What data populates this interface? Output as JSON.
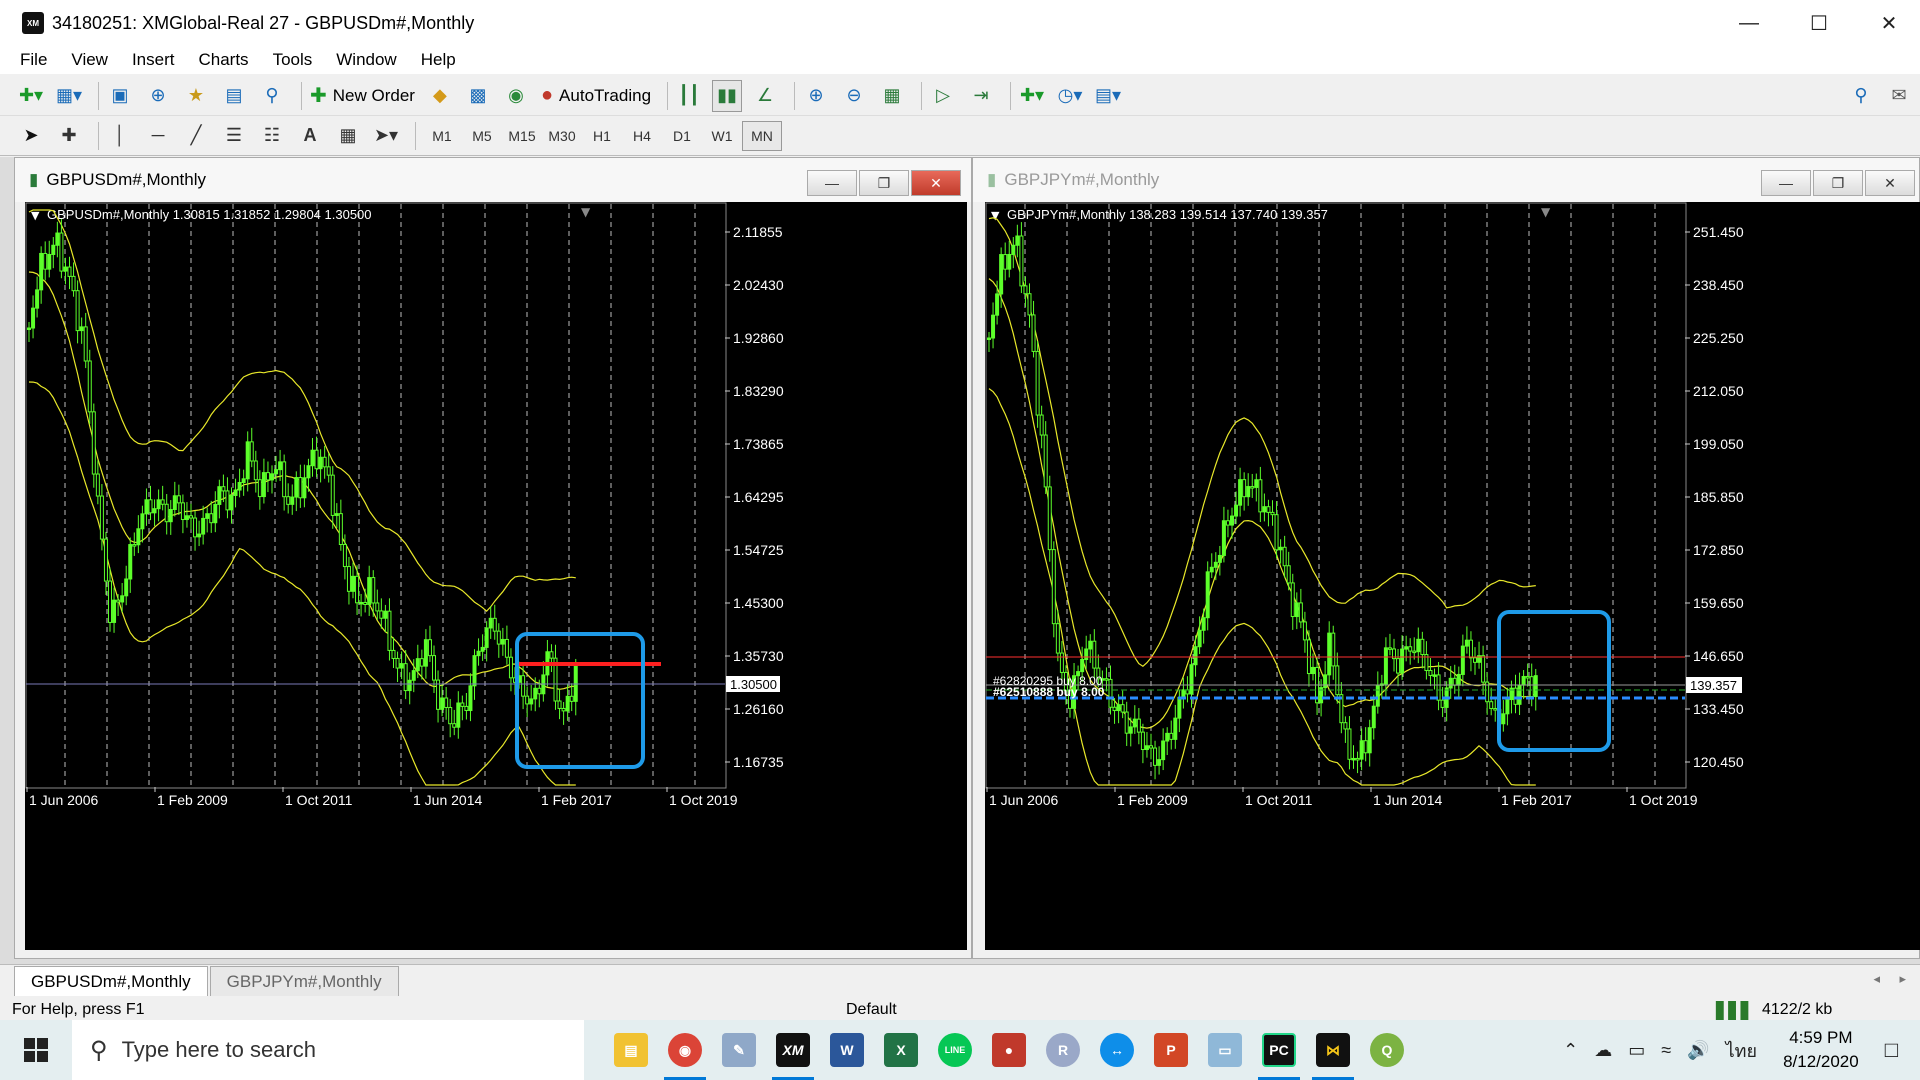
{
  "window": {
    "title": "34180251: XMGlobal-Real 27 - GBPUSDm#,Monthly",
    "logo_text": "XM"
  },
  "menu": [
    "File",
    "View",
    "Insert",
    "Charts",
    "Tools",
    "Window",
    "Help"
  ],
  "toolbar": {
    "new_order": "New Order",
    "auto_trading": "AutoTrading"
  },
  "timeframes": [
    "M1",
    "M5",
    "M15",
    "M30",
    "H1",
    "H4",
    "D1",
    "W1",
    "MN"
  ],
  "active_timeframe": "MN",
  "chart1": {
    "title": "GBPUSDm#,Monthly",
    "header": "GBPUSDm#,Monthly  1.30815 1.31852 1.29804 1.30500",
    "price_labels": [
      "2.11855",
      "2.02430",
      "1.92860",
      "1.83290",
      "1.73865",
      "1.64295",
      "1.54725",
      "1.45300",
      "1.35730",
      "1.26160",
      "1.16735"
    ],
    "current_price": "1.30500",
    "date_labels": [
      "1 Jun 2006",
      "1 Feb 2009",
      "1 Oct 2011",
      "1 Jun 2014",
      "1 Feb 2017",
      "1 Oct 2019"
    ]
  },
  "chart2": {
    "title": "GBPJPYm#,Monthly",
    "header": "GBPJPYm#,Monthly  138.283 139.514 137.740 139.357",
    "price_labels": [
      "251.450",
      "238.450",
      "225.250",
      "212.050",
      "199.050",
      "185.850",
      "172.850",
      "159.650",
      "146.650",
      "133.450",
      "120.450"
    ],
    "current_price": "139.357",
    "order_label_1": "#62820295 buy 8.00",
    "order_label_2": "#62510888 buy 8.00",
    "date_labels": [
      "1 Jun 2006",
      "1 Feb 2009",
      "1 Oct 2011",
      "1 Jun 2014",
      "1 Feb 2017",
      "1 Oct 2019"
    ]
  },
  "tabs": [
    "GBPUSDm#,Monthly",
    "GBPJPYm#,Monthly"
  ],
  "status": {
    "help": "For Help, press F1",
    "profile": "Default",
    "traffic": "4122/2 kb"
  },
  "taskbar": {
    "search_placeholder": "Type here to search",
    "time": "4:59 PM",
    "date": "8/12/2020",
    "lang": "ไทย"
  },
  "colors": {
    "candle": "#5cff2a",
    "band": "#e8e82a",
    "highlight_box": "#1e9ae8",
    "resistance": "#ff2020",
    "support": "#2a8cff"
  }
}
